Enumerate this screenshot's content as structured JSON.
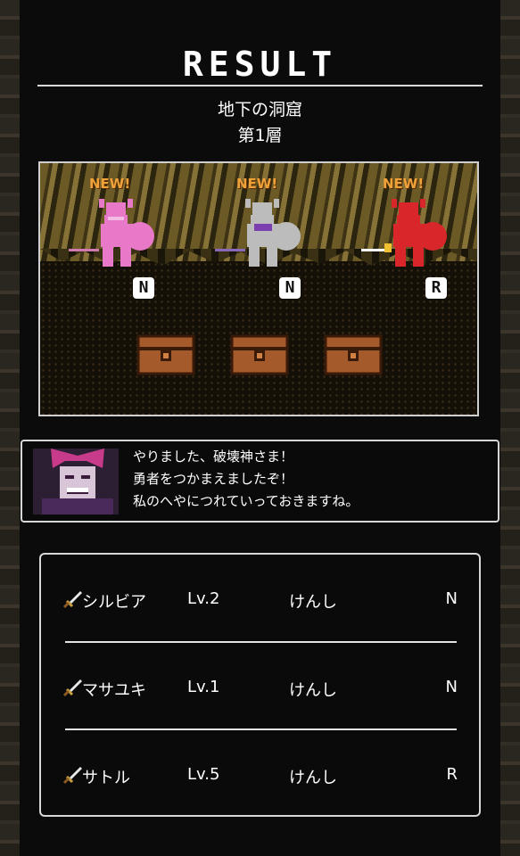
{
  "screen": {
    "title": "RESULT",
    "dungeon_name": "地下の洞窟",
    "floor_label": "第1層"
  },
  "scene": {
    "heroes": [
      {
        "new_label": "NEW!",
        "rarity": "N",
        "color": "#e879c8"
      },
      {
        "new_label": "NEW!",
        "rarity": "N",
        "color": "#bcbcbc"
      },
      {
        "new_label": "NEW!",
        "rarity": "R",
        "color": "#d8262a"
      }
    ],
    "chest_count": 3
  },
  "message": {
    "lines": [
      "やりました、破壊神さま！",
      "勇者をつかまえましたぞ！",
      "私のへやにつれていっておきますね。"
    ]
  },
  "party": [
    {
      "name": "シルビア",
      "level": "Lv.2",
      "class": "けんし",
      "rarity": "N"
    },
    {
      "name": "マサユキ",
      "level": "Lv.1",
      "class": "けんし",
      "rarity": "N"
    },
    {
      "name": "サトル",
      "level": "Lv.5",
      "class": "けんし",
      "rarity": "R"
    }
  ],
  "colors": {
    "accent_new": "#f0a23a",
    "frame": "#d7d7d7",
    "background": "#0a0a0a"
  }
}
